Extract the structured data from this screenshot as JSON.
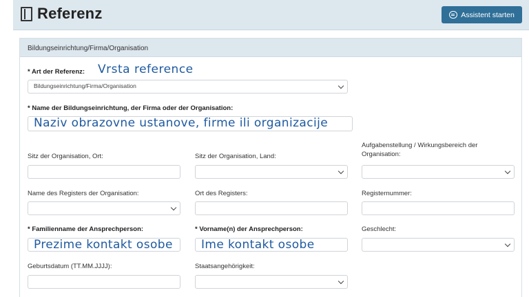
{
  "header": {
    "title": "Referenz",
    "assistant_button": "Assistent starten"
  },
  "panel": {
    "heading": "Bildungseinrichtung/Firma/Organisation"
  },
  "reference_type": {
    "label": "* Art der Referenz:",
    "annotation": "Vrsta reference",
    "value": "Bildungseinrichtung/Firma/Organisation"
  },
  "org_name": {
    "label": "* Name der Bildungseinrichtung, der Firma oder der Organisation:",
    "value": "Naziv obrazovne ustanove, firme ili organizacije"
  },
  "org_city": {
    "label": "Sitz der Organisation, Ort:",
    "value": ""
  },
  "org_country": {
    "label": "Sitz der Organisation, Land:",
    "value": ""
  },
  "org_task": {
    "label": "Aufgabenstellung / Wirkungsbereich der Organisation:",
    "value": ""
  },
  "register_name": {
    "label": "Name des Registers der Organisation:",
    "value": ""
  },
  "register_place": {
    "label": "Ort des Registers:",
    "value": ""
  },
  "register_number": {
    "label": "Registernummer:",
    "value": ""
  },
  "contact_lastname": {
    "label": "* Familienname der Ansprechperson:",
    "value": "Prezime kontakt osobe"
  },
  "contact_firstname": {
    "label": "* Vorname(n) der Ansprechperson:",
    "value": "Ime kontakt osobe"
  },
  "gender": {
    "label": "Geschlecht:",
    "value": ""
  },
  "birthdate": {
    "label": "Geburtsdatum (TT.MM.JJJJ):",
    "value": ""
  },
  "nationality": {
    "label": "Staatsangehörigkeit:",
    "value": ""
  }
}
